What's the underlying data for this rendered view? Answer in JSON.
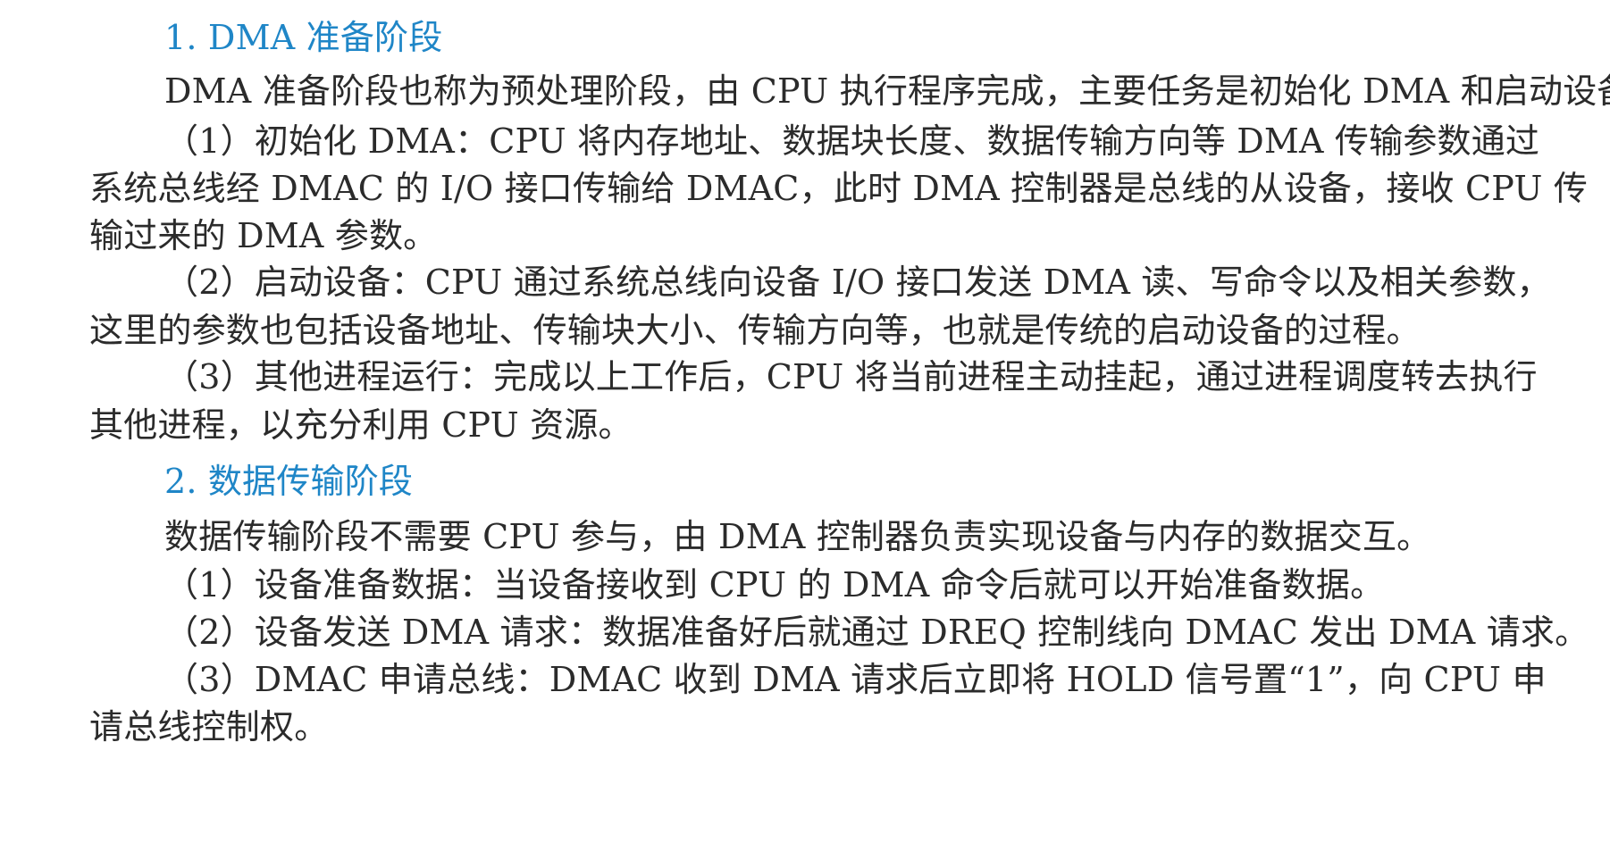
{
  "sections": [
    {
      "heading": "1.  DMA 准备阶段",
      "intro": "DMA 准备阶段也称为预处理阶段，由 CPU 执行程序完成，主要任务是初始化 DMA 和启动设备。",
      "items": [
        {
          "lines": [
            "（1）初始化 DMA：CPU 将内存地址、数据块长度、数据传输方向等 DMA 传输参数通过",
            "系统总线经 DMAC 的 I/O 接口传输给 DMAC，此时 DMA 控制器是总线的从设备，接收 CPU 传",
            "输过来的 DMA 参数。"
          ]
        },
        {
          "lines": [
            "（2）启动设备：CPU 通过系统总线向设备 I/O 接口发送 DMA 读、写命令以及相关参数，",
            "这里的参数也包括设备地址、传输块大小、传输方向等，也就是传统的启动设备的过程。"
          ]
        },
        {
          "lines": [
            "（3）其他进程运行：完成以上工作后，CPU 将当前进程主动挂起，通过进程调度转去执行",
            "其他进程，以充分利用 CPU 资源。"
          ]
        }
      ]
    },
    {
      "heading": "2.  数据传输阶段",
      "intro": "数据传输阶段不需要 CPU 参与，由 DMA 控制器负责实现设备与内存的数据交互。",
      "items": [
        {
          "lines": [
            "（1）设备准备数据：当设备接收到 CPU 的 DMA 命令后就可以开始准备数据。"
          ]
        },
        {
          "lines": [
            "（2）设备发送 DMA 请求：数据准备好后就通过 DREQ 控制线向 DMAC 发出 DMA 请求。"
          ]
        },
        {
          "lines": [
            "（3）DMAC 申请总线：DMAC 收到 DMA 请求后立即将 HOLD 信号置“1”，向 CPU 申",
            "请总线控制权。"
          ]
        }
      ]
    }
  ]
}
